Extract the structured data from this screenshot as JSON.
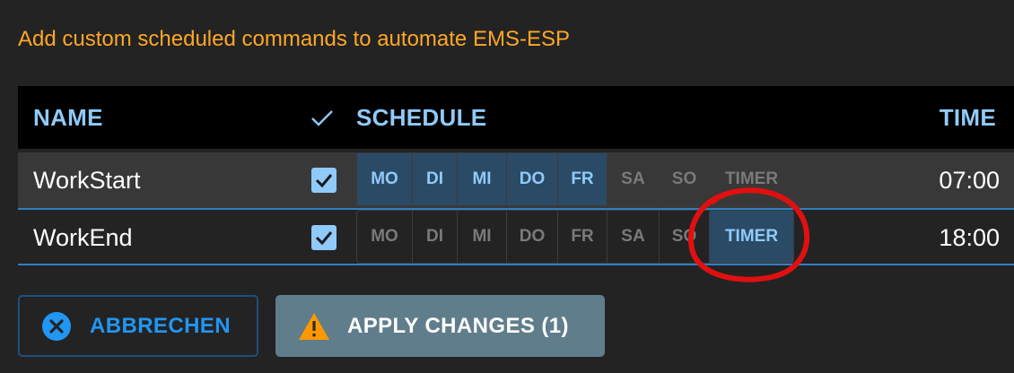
{
  "intro_text": "Add custom scheduled commands to automate EMS-ESP",
  "table": {
    "headers": {
      "name": "NAME",
      "enabled_icon": "check-icon",
      "schedule": "SCHEDULE",
      "time": "TIME"
    },
    "rows": [
      {
        "name": "WorkStart",
        "enabled": true,
        "days": [
          {
            "label": "MO",
            "active": true
          },
          {
            "label": "DI",
            "active": true
          },
          {
            "label": "MI",
            "active": true
          },
          {
            "label": "DO",
            "active": true
          },
          {
            "label": "FR",
            "active": true
          },
          {
            "label": "SA",
            "active": false
          },
          {
            "label": "SO",
            "active": false
          },
          {
            "label": "TIMER",
            "active": false
          }
        ],
        "time": "07:00"
      },
      {
        "name": "WorkEnd",
        "enabled": true,
        "days": [
          {
            "label": "MO",
            "active": false
          },
          {
            "label": "DI",
            "active": false
          },
          {
            "label": "MI",
            "active": false
          },
          {
            "label": "DO",
            "active": false
          },
          {
            "label": "FR",
            "active": false
          },
          {
            "label": "SA",
            "active": false
          },
          {
            "label": "SO",
            "active": false
          },
          {
            "label": "TIMER",
            "active": true
          }
        ],
        "time": "18:00"
      }
    ]
  },
  "buttons": {
    "cancel_label": "ABBRECHEN",
    "cancel_icon": "cancel-circle-icon",
    "apply_label": "APPLY CHANGES (1)",
    "apply_icon": "warning-icon"
  },
  "colors": {
    "accent_orange": "#ffa726",
    "accent_blue": "#90caf9",
    "primary_blue": "#2196f3",
    "warning": "#ff9800",
    "annotation_red": "#e01010"
  }
}
